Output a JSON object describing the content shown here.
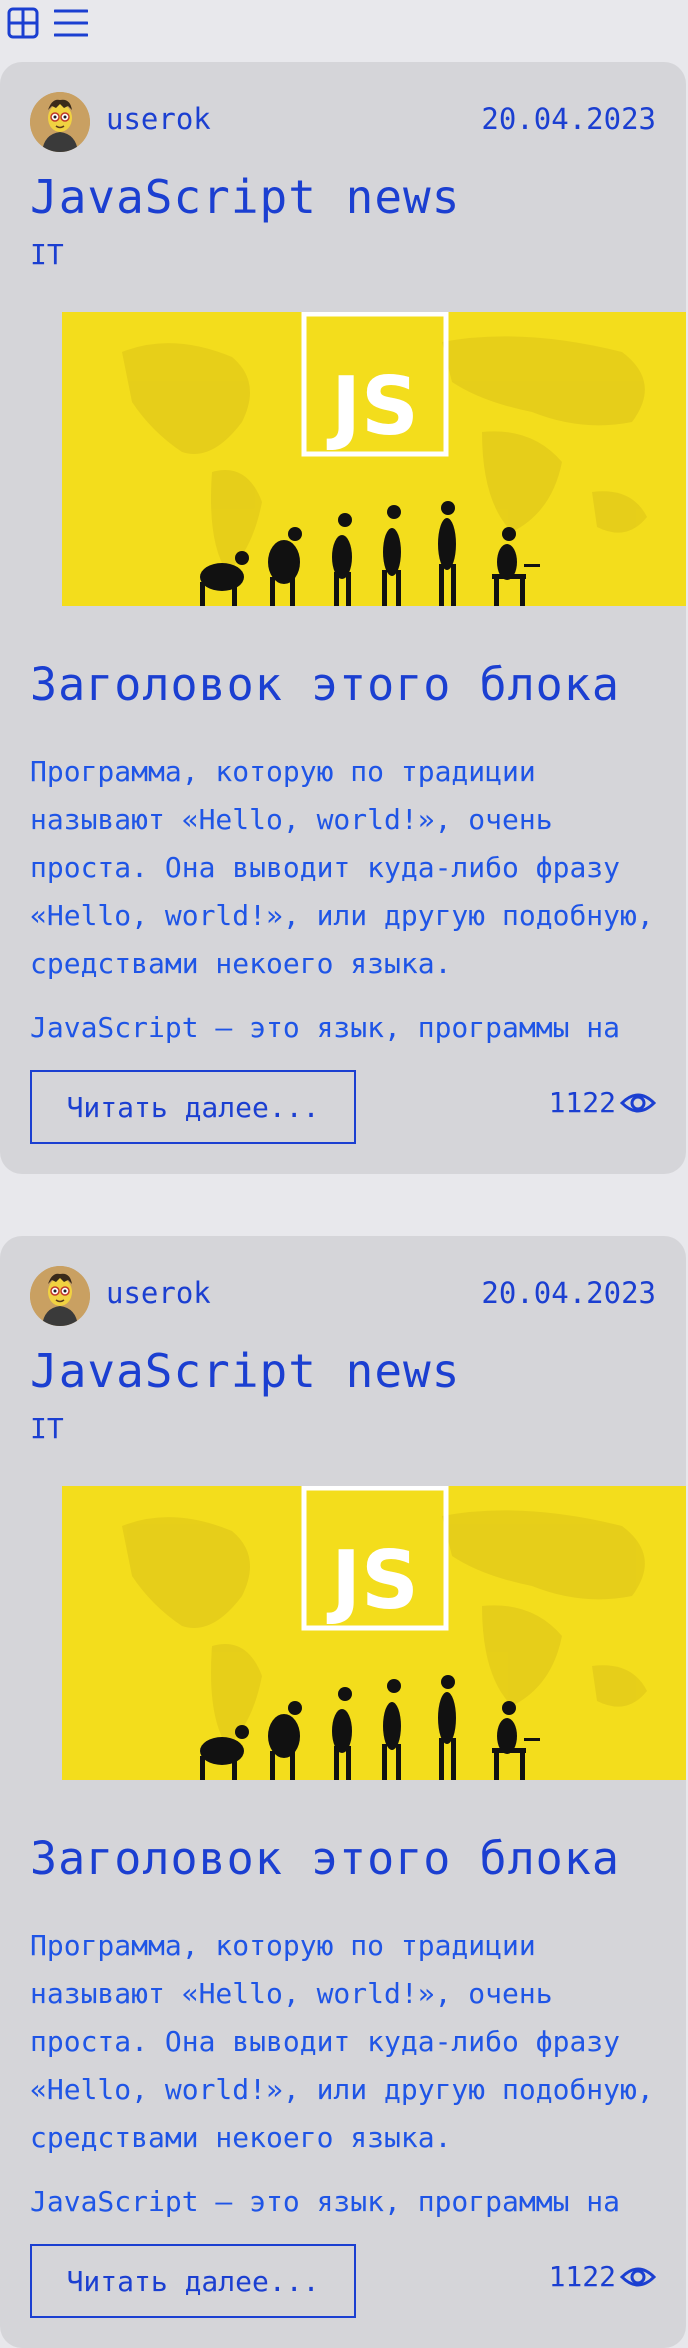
{
  "view_controls": {
    "grid_icon": "grid-view-icon",
    "list_icon": "list-view-icon",
    "accent": "#1b3fd1"
  },
  "posts": [
    {
      "author": "userok",
      "date": "20.04.2023",
      "title": "JavaScript news",
      "category": "IT",
      "banner_label": "JS",
      "heading": "Заголовок этого блока",
      "paragraphs": [
        "Программа, которую по традиции называют «Hello, world!», очень проста. Она выводит куда-либо фразу «Hello, world!», или другую подобную, средствами некоего языка.",
        "JavaScript — это язык, программы на"
      ],
      "read_more": "Читать далее...",
      "views": "1122"
    },
    {
      "author": "userok",
      "date": "20.04.2023",
      "title": "JavaScript news",
      "category": "IT",
      "banner_label": "JS",
      "heading": "Заголовок этого блока",
      "paragraphs": [
        "Программа, которую по традиции называют «Hello, world!», очень проста. Она выводит куда-либо фразу «Hello, world!», или другую подобную, средствами некоего языка.",
        "JavaScript — это язык, программы на"
      ],
      "read_more": "Читать далее...",
      "views": "1122"
    }
  ],
  "colors": {
    "page_bg": "#e8e8ec",
    "card_bg": "#d5d5d9",
    "text": "#1b3fd1",
    "banner_bg": "#f3dd1c"
  }
}
